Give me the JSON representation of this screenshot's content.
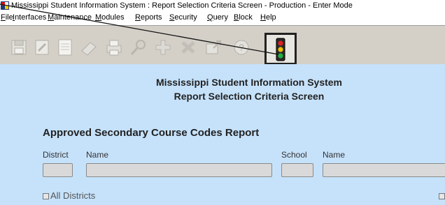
{
  "window": {
    "title": "Mississippi Student Information System : Report Selection Criteria Screen  -  Production  -  Enter Mode",
    "app_icon": "app-flag-icon"
  },
  "menu": {
    "items": [
      "File",
      "Interfaces",
      "Maintenance",
      "Modules",
      "Reports",
      "Security",
      "Query",
      "Block",
      "Help"
    ]
  },
  "toolbar": {
    "buttons": [
      {
        "icon": "save-icon",
        "enabled": false
      },
      {
        "icon": "edit-icon",
        "enabled": false
      },
      {
        "icon": "document-icon",
        "enabled": false
      },
      {
        "icon": "eraser-icon",
        "enabled": false
      },
      {
        "icon": "print-icon",
        "enabled": false
      },
      {
        "icon": "search-icon",
        "enabled": false
      },
      {
        "icon": "add-icon",
        "enabled": false
      },
      {
        "icon": "delete-icon",
        "enabled": false
      },
      {
        "icon": "export-icon",
        "enabled": false
      },
      {
        "icon": "help-icon",
        "enabled": false
      },
      {
        "icon": "traffic-light-icon",
        "enabled": true,
        "highlighted": true
      }
    ]
  },
  "form": {
    "heading_line1": "Mississippi Student Information System",
    "heading_line2": "Report Selection Criteria Screen",
    "report_title": "Approved Secondary Course Codes Report",
    "labels": {
      "district": "District",
      "district_name": "Name",
      "school": "School",
      "school_name": "Name"
    },
    "fields": {
      "district": "",
      "district_name": "",
      "school": "",
      "school_name": ""
    },
    "checkboxes": {
      "all_districts": "All Districts"
    }
  },
  "colors": {
    "form_background": "#c6e2fb",
    "toolbar_background": "#d4d0c8",
    "field_fill": "#d9d9d9"
  }
}
